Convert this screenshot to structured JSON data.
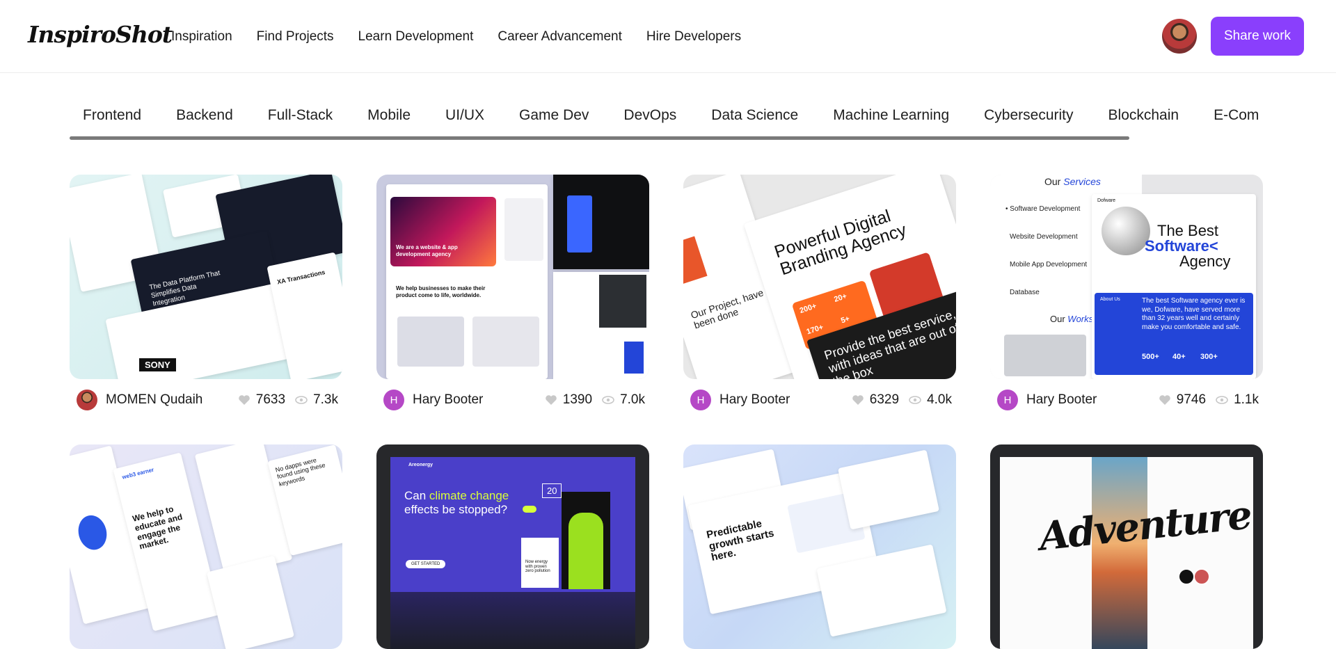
{
  "header": {
    "logo": "InspiroShot",
    "nav": [
      "Inspiration",
      "Find Projects",
      "Learn Development",
      "Career Advancement",
      "Hire Developers"
    ],
    "share_label": "Share work"
  },
  "categories": [
    "Frontend",
    "Backend",
    "Full-Stack",
    "Mobile",
    "UI/UX",
    "Game Dev",
    "DevOps",
    "Data Science",
    "Machine Learning",
    "Cybersecurity",
    "Blockchain",
    "E-Com"
  ],
  "cards": [
    {
      "author": "MOMEN Qudaih",
      "initial": "",
      "likes": "7633",
      "views": "7.3k"
    },
    {
      "author": "Hary Booter",
      "initial": "H",
      "likes": "1390",
      "views": "7.0k"
    },
    {
      "author": "Hary Booter",
      "initial": "H",
      "likes": "6329",
      "views": "4.0k"
    },
    {
      "author": "Hary Booter",
      "initial": "H",
      "likes": "9746",
      "views": "1.1k"
    }
  ],
  "thumbs": {
    "t1": {
      "headline": "The Data Platform That Simplifies Data Integration",
      "side": "XA Transactions",
      "brand": "SONY"
    },
    "t2": {
      "headline": "We are a website & app development agency",
      "sub": "We help businesses to make their product come to life, worldwide."
    },
    "t3": {
      "headline": "Powerful Digital Branding Agency",
      "left": "Our Project, have been done",
      "bottom": "Provide the best service, with ideas that are out of the box",
      "stats": [
        "200+",
        "20+",
        "170+",
        "5+"
      ]
    },
    "t4": {
      "services_prefix": "Our",
      "services_word": "Services",
      "menu": [
        "Software Development",
        "Website Development",
        "Mobile App Development",
        "Database"
      ],
      "works_prefix": "Our",
      "works_word": "Works",
      "headline_line1": "The Best",
      "headline_line2": "Software<",
      "headline_line3": "Agency",
      "about_label": "About Us",
      "about_text": "The best Software agency ever is we, Dofware, have served more than 32 years well and certainly make you comfortable and safe.",
      "stats": [
        "500+",
        "40+",
        "300+"
      ],
      "brand": "Dofware"
    },
    "t5": {
      "headline": "We help to educate and engage the market.",
      "brand": "web3 earner",
      "right": "No dapps were found using these keywords"
    },
    "t6": {
      "brand": "Areonergy",
      "headline_a": "Can ",
      "headline_b": "climate change",
      "headline_c": " effects be stopped?",
      "stat": "20",
      "side": "Now energy with proven zero pollution",
      "cta": "GET STARTED"
    },
    "t7": {
      "headline": "Predictable growth starts here."
    },
    "t8": {
      "headline": "Adventure"
    }
  },
  "colors": {
    "accent": "#8a3ffc",
    "author_avatar": "#b548c6",
    "service_blue": "#2345d8"
  }
}
